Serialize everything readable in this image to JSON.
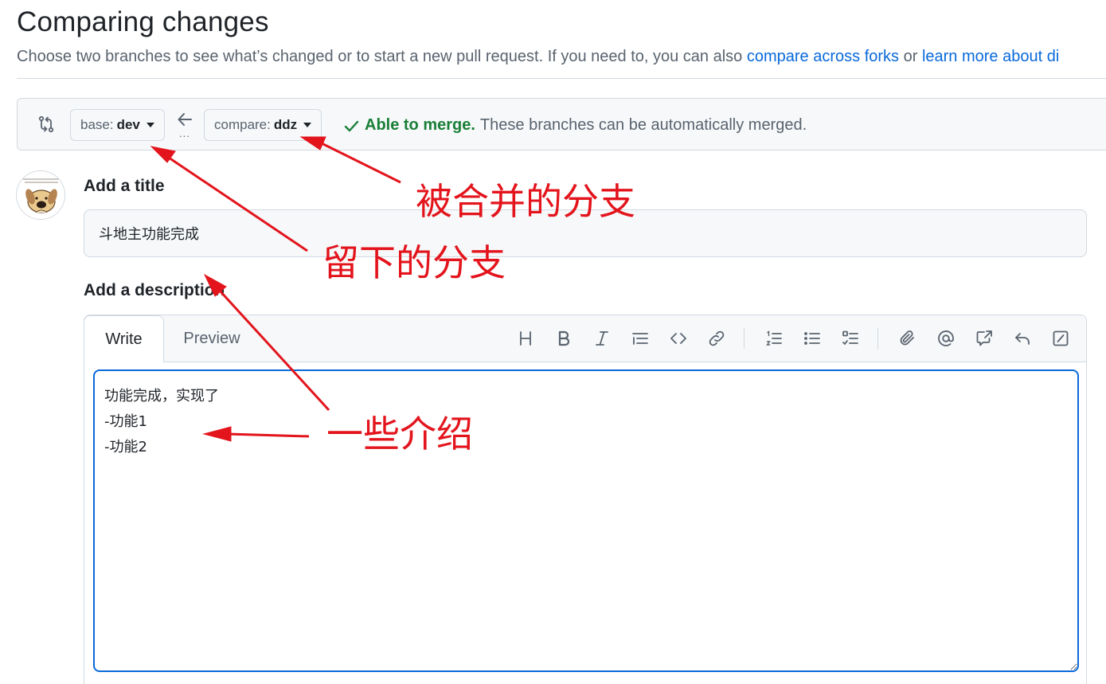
{
  "header": {
    "title": "Comparing changes",
    "subtitle_prefix": "Choose two branches to see what’s changed or to start a new pull request. If you need to, you can also ",
    "link_forks": "compare across forks",
    "subtitle_middle": " or ",
    "link_learn": "learn more about di"
  },
  "compare": {
    "base_prefix": "base:",
    "base_branch": "dev",
    "ellipsis": "...",
    "compare_prefix": "compare:",
    "compare_branch": "ddz",
    "merge_ok": "Able to merge.",
    "merge_detail": "These branches can be automatically merged."
  },
  "form": {
    "title_label": "Add a title",
    "title_value": "斗地主功能完成",
    "description_label": "Add a description",
    "description_value": "功能完成，实现了\n-功能1\n-功能2"
  },
  "editor": {
    "tab_write": "Write",
    "tab_preview": "Preview",
    "toolbar_icons": [
      "heading-icon",
      "bold-icon",
      "italic-icon",
      "quote-icon",
      "code-icon",
      "link-icon",
      "ordered-list-icon",
      "unordered-list-icon",
      "task-list-icon",
      "attach-icon",
      "mention-icon",
      "reference-icon",
      "reply-icon",
      "slash-command-icon"
    ]
  },
  "annotations": {
    "merged_branch": "被合并的分支",
    "kept_branch": "留下的分支",
    "intro": "一些介绍"
  },
  "colors": {
    "link": "#0969da",
    "success": "#1a7f37",
    "focus": "#0969da",
    "annotation": "#e3141c",
    "border": "#d1d9e0",
    "muted": "#59636e"
  }
}
